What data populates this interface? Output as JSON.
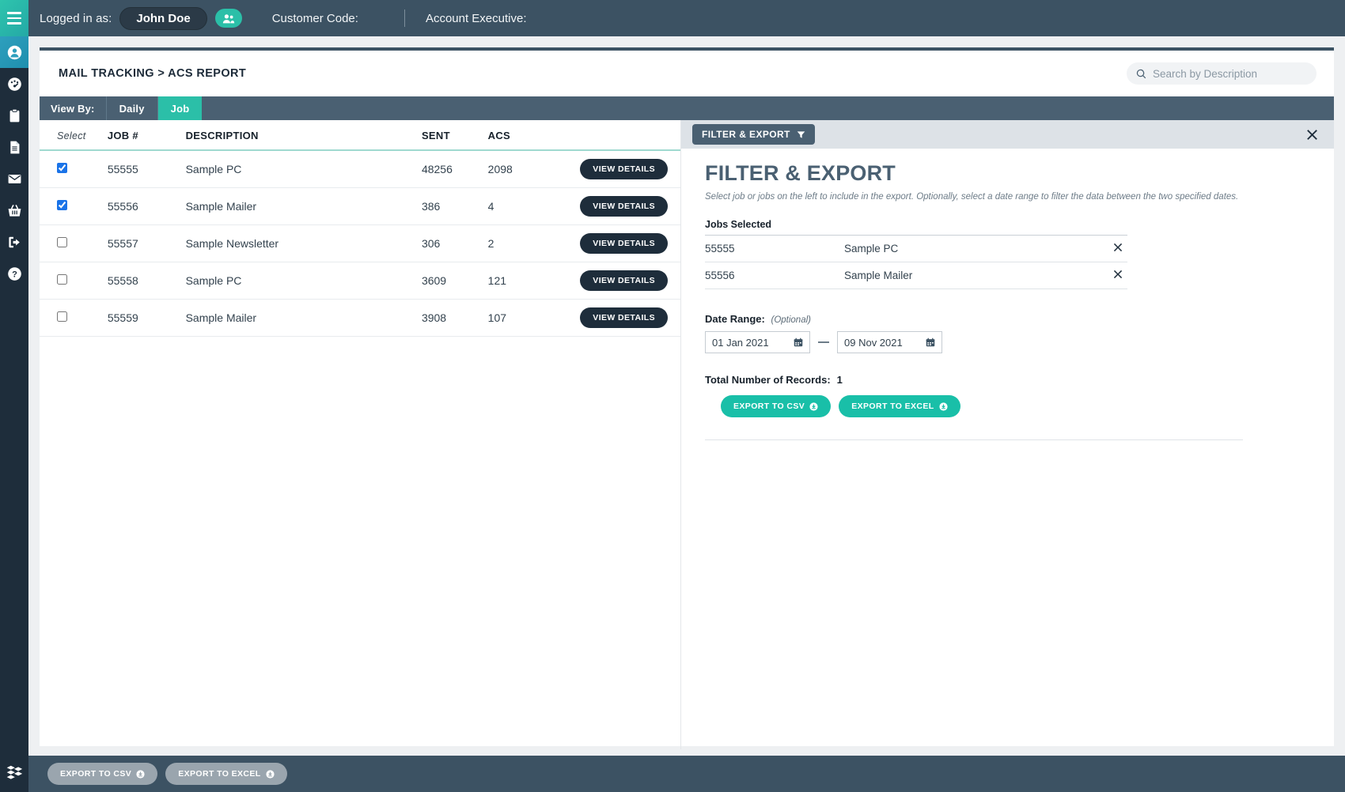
{
  "topbar": {
    "logged_in_label": "Logged in as:",
    "user_name": "John Doe",
    "customer_code_label": "Customer Code:",
    "account_executive_label": "Account Executive:"
  },
  "sidebar": {
    "items": [
      {
        "icon": "user-account-icon",
        "active": true
      },
      {
        "icon": "dashboard-gauge-icon",
        "active": false
      },
      {
        "icon": "clipboard-icon",
        "active": false
      },
      {
        "icon": "document-report-icon",
        "active": false
      },
      {
        "icon": "mail-envelope-icon",
        "active": false
      },
      {
        "icon": "basket-icon",
        "active": false
      },
      {
        "icon": "logout-icon",
        "active": false
      },
      {
        "icon": "help-question-icon",
        "active": false
      }
    ],
    "logo_icon": "stacked-layers-logo"
  },
  "header": {
    "breadcrumb": "MAIL TRACKING > ACS REPORT",
    "search": {
      "placeholder": "Search by Description",
      "value": "",
      "icon": "search-icon"
    }
  },
  "viewbar": {
    "label": "View By:",
    "tabs": [
      {
        "label": "Daily",
        "active": false
      },
      {
        "label": "Job",
        "active": true
      }
    ]
  },
  "table": {
    "columns": [
      "Select",
      "JOB #",
      "DESCRIPTION",
      "SENT",
      "ACS",
      ""
    ],
    "view_details_label": "VIEW DETAILS",
    "rows": [
      {
        "selected": true,
        "job": "55555",
        "description": "Sample PC",
        "sent": "48256",
        "acs": "2098"
      },
      {
        "selected": true,
        "job": "55556",
        "description": "Sample Mailer",
        "sent": "386",
        "acs": "4"
      },
      {
        "selected": false,
        "job": "55557",
        "description": "Sample Newsletter",
        "sent": "306",
        "acs": "2"
      },
      {
        "selected": false,
        "job": "55558",
        "description": "Sample PC",
        "sent": "3609",
        "acs": "121"
      },
      {
        "selected": false,
        "job": "55559",
        "description": "Sample Mailer",
        "sent": "3908",
        "acs": "107"
      }
    ]
  },
  "filter_panel": {
    "toolbar_button": "FILTER & EXPORT",
    "toolbar_icon": "funnel-icon",
    "close_icon": "close-icon",
    "title": "FILTER & EXPORT",
    "description": "Select job or jobs on the left to include in the export. Optionally, select a date range to filter the data between the two specified dates.",
    "jobs_selected_label": "Jobs Selected",
    "jobs_selected": [
      {
        "job": "55555",
        "description": "Sample PC"
      },
      {
        "job": "55556",
        "description": "Sample Mailer"
      }
    ],
    "date_range_label": "Date Range:",
    "date_range_optional": "(Optional)",
    "date_start": "01 Jan 2021",
    "date_end": "09 Nov 2021",
    "total_records_label": "Total Number of Records:",
    "total_records_value": "1",
    "export_csv_label": "EXPORT TO CSV",
    "export_excel_label": "EXPORT TO EXCEL"
  },
  "bottombar": {
    "export_csv_label": "EXPORT TO CSV",
    "export_excel_label": "EXPORT TO EXCEL"
  },
  "colors": {
    "teal": "#2bbfa8",
    "dark_navy": "#1e2d3b",
    "slate": "#4a6072",
    "topbar": "#3c5263",
    "checkbox_blue": "#1a73e8"
  }
}
